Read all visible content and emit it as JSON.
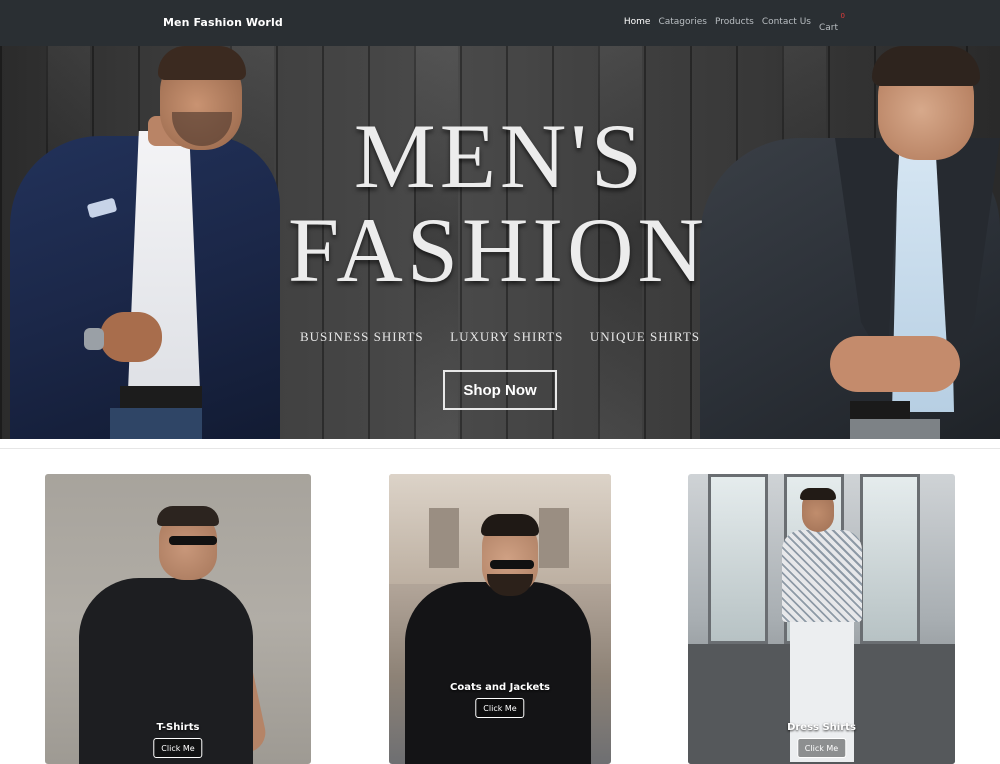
{
  "nav": {
    "brand": "Men Fashion World",
    "links": [
      "Home",
      "Catagories",
      "Products",
      "Contact Us",
      "Cart"
    ],
    "cart_count": "0"
  },
  "hero": {
    "title_line1": "MEN'S",
    "title_line2": "FASHION",
    "subtitles": [
      "BUSINESS SHIRTS",
      "LUXURY SHIRTS",
      "UNIQUE SHIRTS"
    ],
    "cta": "Shop Now"
  },
  "categories": [
    {
      "label": "T-Shirts",
      "button": "Click Me"
    },
    {
      "label": "Coats and Jackets",
      "button": "Click Me"
    },
    {
      "label": "Dress Shirts",
      "button": "Click Me"
    }
  ],
  "colors": {
    "navbar": "#2a2f33",
    "cart_badge": "#e23b3b"
  }
}
